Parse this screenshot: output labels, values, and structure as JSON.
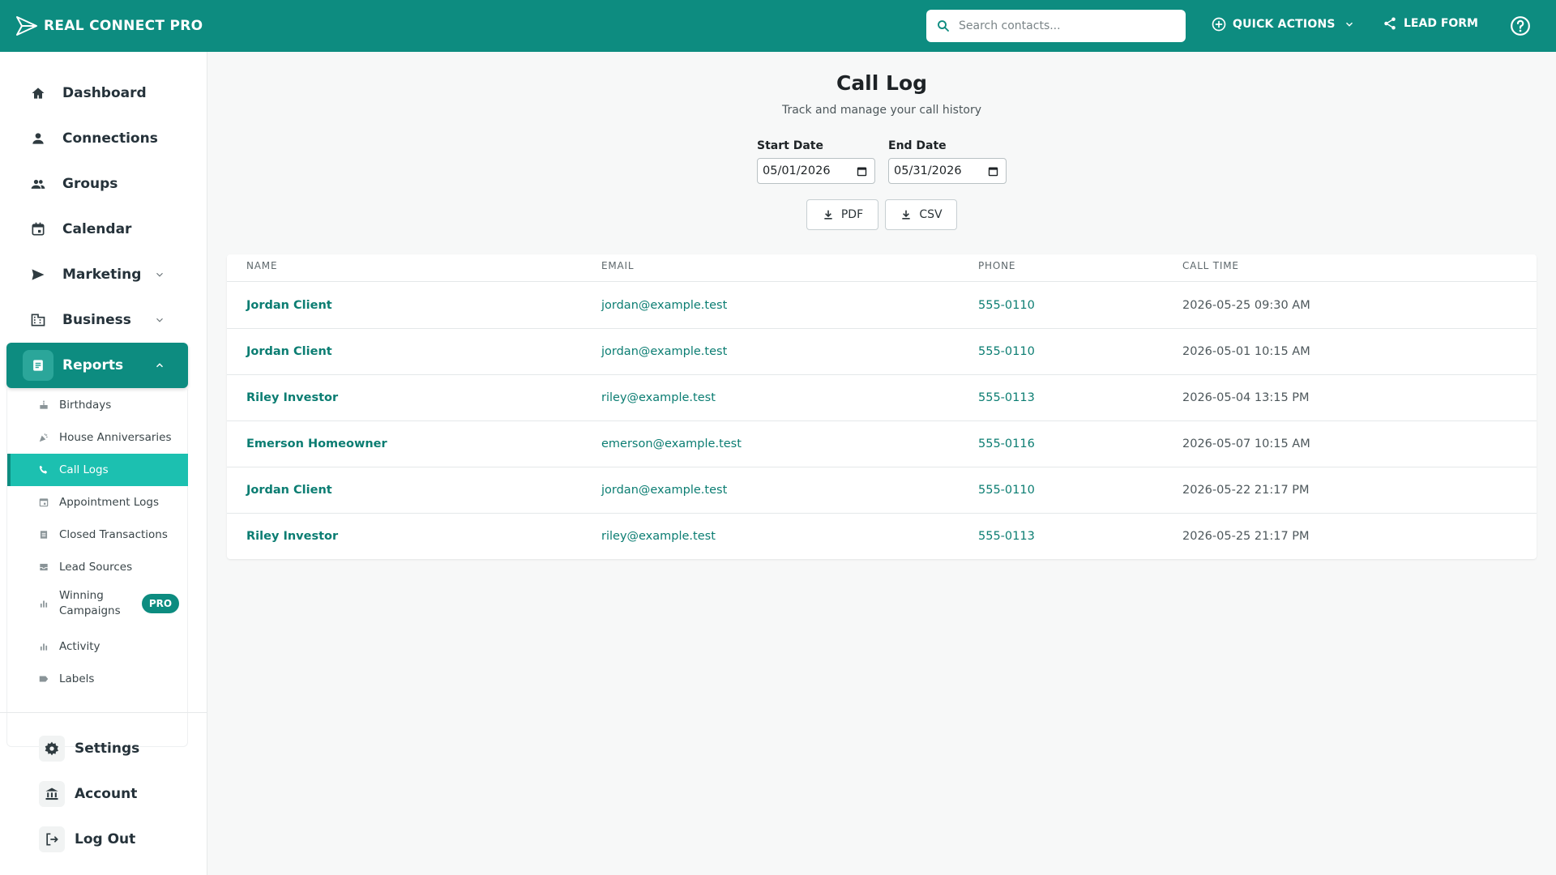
{
  "brand": {
    "name": "REAL CONNECT PRO",
    "icon": "paper-plane-logo-icon"
  },
  "header": {
    "search_placeholder": "Search contacts...",
    "quick_actions_label": "QUICK ACTIONS",
    "lead_form_label": "LEAD FORM"
  },
  "sidebar": {
    "items": [
      {
        "label": "Dashboard",
        "icon": "home-icon"
      },
      {
        "label": "Connections",
        "icon": "person-icon"
      },
      {
        "label": "Groups",
        "icon": "people-icon"
      },
      {
        "label": "Calendar",
        "icon": "calendar-icon"
      },
      {
        "label": "Marketing",
        "icon": "send-icon"
      },
      {
        "label": "Business",
        "icon": "building-icon"
      },
      {
        "label": "Reports",
        "icon": "report-icon"
      }
    ],
    "reports_sub": [
      {
        "label": "Birthdays",
        "icon": "cake-icon"
      },
      {
        "label": "House Anniversaries",
        "icon": "celebration-icon"
      },
      {
        "label": "Call Logs",
        "icon": "phone-icon"
      },
      {
        "label": "Appointment Logs",
        "icon": "calendar-icon"
      },
      {
        "label": "Closed Transactions",
        "icon": "document-icon"
      },
      {
        "label": "Lead Sources",
        "icon": "inbox-icon"
      },
      {
        "label": "Winning Campaigns",
        "icon": "bar-chart-icon",
        "badge": "PRO"
      },
      {
        "label": "Activity",
        "icon": "bar-chart-icon"
      },
      {
        "label": "Labels",
        "icon": "label-icon"
      }
    ],
    "footer": [
      {
        "label": "Settings",
        "icon": "gear-icon"
      },
      {
        "label": "Account",
        "icon": "bank-icon"
      },
      {
        "label": "Log Out",
        "icon": "logout-icon"
      }
    ]
  },
  "page": {
    "title": "Call Log",
    "subtitle": "Track and manage your call history",
    "start_label": "Start Date",
    "start_value": "05/01/2026",
    "end_label": "End Date",
    "end_value": "05/31/2026",
    "pdf_label": "PDF",
    "csv_label": "CSV"
  },
  "table": {
    "columns": [
      "NAME",
      "EMAIL",
      "PHONE",
      "CALL TIME"
    ],
    "rows": [
      {
        "name": "Jordan Client",
        "email": "jordan@example.test",
        "phone": "555-0110",
        "time": "2026-05-25 09:30 AM"
      },
      {
        "name": "Jordan Client",
        "email": "jordan@example.test",
        "phone": "555-0110",
        "time": "2026-05-01 10:15 AM"
      },
      {
        "name": "Riley Investor",
        "email": "riley@example.test",
        "phone": "555-0113",
        "time": "2026-05-04 13:15 PM"
      },
      {
        "name": "Emerson Homeowner",
        "email": "emerson@example.test",
        "phone": "555-0116",
        "time": "2026-05-07 10:15 AM"
      },
      {
        "name": "Jordan Client",
        "email": "jordan@example.test",
        "phone": "555-0110",
        "time": "2026-05-22 21:17 PM"
      },
      {
        "name": "Riley Investor",
        "email": "riley@example.test",
        "phone": "555-0113",
        "time": "2026-05-25 21:17 PM"
      }
    ]
  },
  "colors": {
    "primary": "#0d8c80",
    "active_sub": "#1cc0b0",
    "link": "#0b7d72"
  }
}
